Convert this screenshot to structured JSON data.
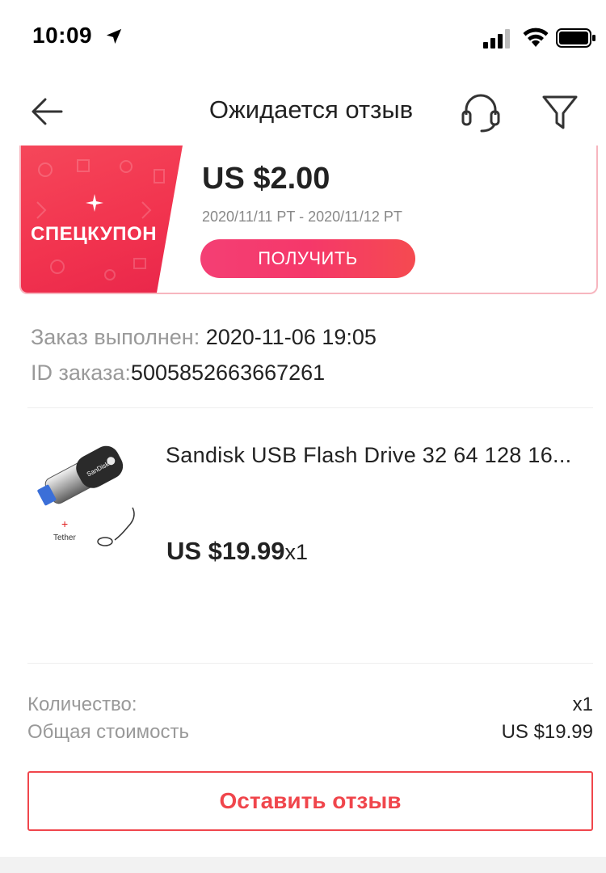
{
  "status_bar": {
    "time": "10:09"
  },
  "header": {
    "title": "Ожидается отзыв"
  },
  "coupon": {
    "label": "СПЕЦКУПОН",
    "amount": "US $2.00",
    "dates": "2020/11/11 PT - 2020/11/12 PT",
    "button_label": "ПОЛУЧИТЬ"
  },
  "order": {
    "completed_label": "Заказ выполнен:",
    "completed_value": " 2020-11-06 19:05",
    "id_label": "ID заказа:",
    "id_value": "5005852663667261"
  },
  "product": {
    "title": "Sandisk USB Flash Drive 32 64 128 16...",
    "price": "US $19.99",
    "quantity": "x1",
    "image_caption": "Tether",
    "image_brand": "SanDisk"
  },
  "summary": {
    "quantity_label": "Количество:",
    "quantity_value": "x1",
    "total_label": "Общая стоимость",
    "total_value": "US $19.99"
  },
  "review_button": {
    "label": "Оставить отзыв"
  },
  "colors": {
    "accent": "#f0464c",
    "coupon_red": "#f2344f",
    "coupon_border": "#f7b6bf"
  }
}
